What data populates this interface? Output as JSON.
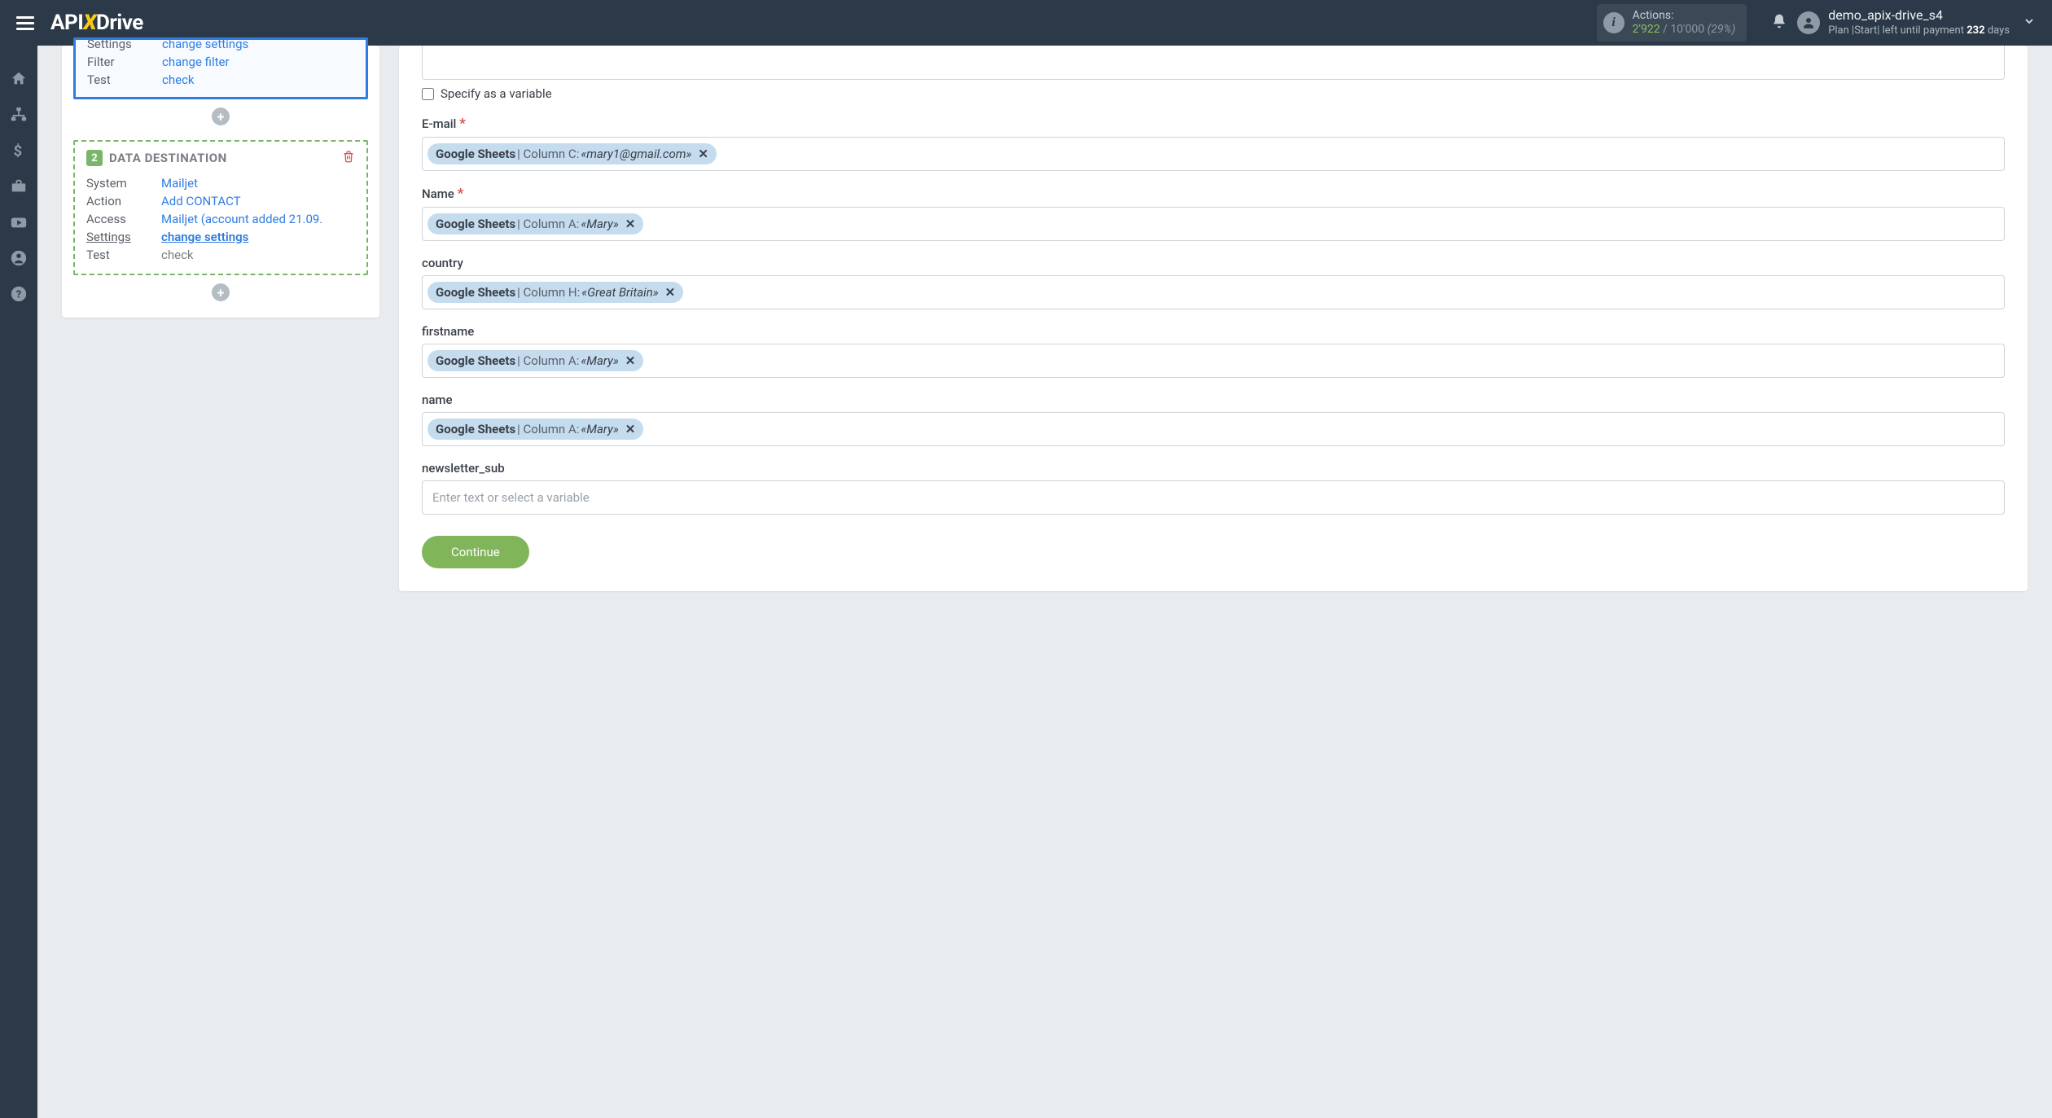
{
  "header": {
    "logo_api": "API",
    "logo_x": "X",
    "logo_drive": "Drive",
    "actions_label": "Actions:",
    "actions_count": "2'922",
    "actions_sep": " / ",
    "actions_total": "10'000",
    "actions_percent": "(29%)",
    "user_name": "demo_apix-drive_s4",
    "plan_prefix": "Plan |Start| left until payment ",
    "plan_days": "232",
    "plan_suffix": " days"
  },
  "source_card": {
    "rows": [
      {
        "label": "Settings",
        "value": "change settings"
      },
      {
        "label": "Filter",
        "value": "change filter"
      },
      {
        "label": "Test",
        "value": "check"
      }
    ]
  },
  "dest_card": {
    "num": "2",
    "title": "DATA DESTINATION",
    "rows": [
      {
        "label": "System",
        "value": "Mailjet",
        "link": true
      },
      {
        "label": "Action",
        "value": "Add CONTACT",
        "link": true
      },
      {
        "label": "Access",
        "value": "Mailjet (account added 21.09.",
        "link": true
      },
      {
        "label": "Settings",
        "value": "change settings",
        "link": true,
        "underline": true,
        "label_underline": true
      },
      {
        "label": "Test",
        "value": "check",
        "muted": true
      }
    ]
  },
  "form": {
    "specify_variable_label": "Specify as a variable",
    "fields": [
      {
        "label": "E-mail",
        "required": true,
        "tag": {
          "source": "Google Sheets",
          "col": "Column C:",
          "val": "«mary1@gmail.com»"
        }
      },
      {
        "label": "Name",
        "required": true,
        "tag": {
          "source": "Google Sheets",
          "col": "Column A:",
          "val": "«Mary»"
        }
      },
      {
        "label": "country",
        "required": false,
        "tag": {
          "source": "Google Sheets",
          "col": "Column H:",
          "val": "«Great Britain»"
        }
      },
      {
        "label": "firstname",
        "required": false,
        "tag": {
          "source": "Google Sheets",
          "col": "Column A:",
          "val": "«Mary»"
        }
      },
      {
        "label": "name",
        "required": false,
        "tag": {
          "source": "Google Sheets",
          "col": "Column A:",
          "val": "«Mary»"
        }
      },
      {
        "label": "newsletter_sub",
        "required": false,
        "placeholder": "Enter text or select a variable"
      }
    ],
    "continue_label": "Continue"
  }
}
